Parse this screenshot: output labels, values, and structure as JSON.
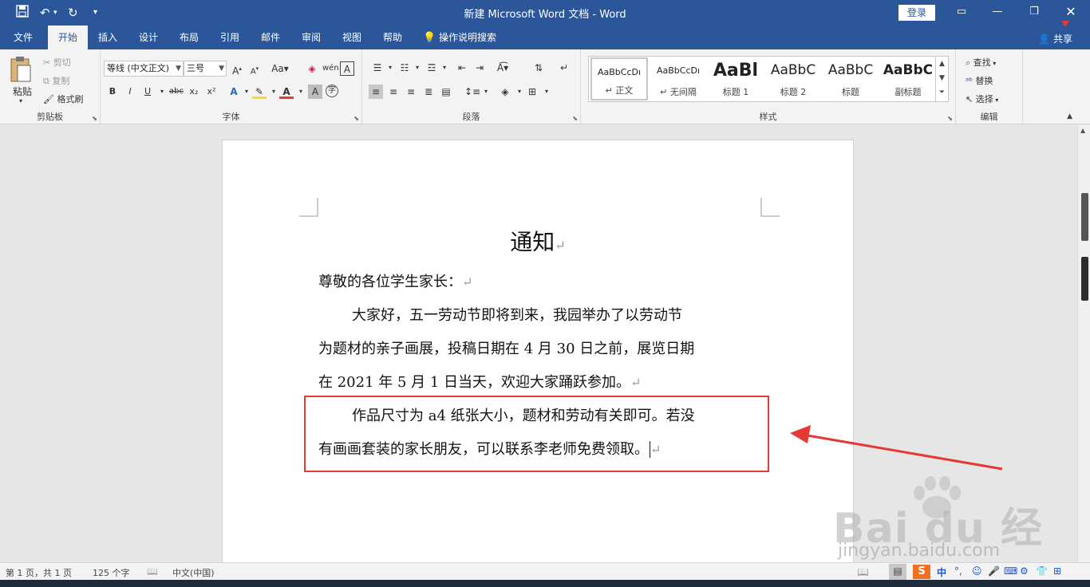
{
  "window": {
    "title": "新建 Microsoft Word 文档  -  Word",
    "login_label": "登录"
  },
  "quick_access": {
    "save_icon": "save-icon",
    "undo_icon": "undo-icon",
    "redo_icon": "redo-icon",
    "customize_icon": "customize-icon"
  },
  "tabs": [
    {
      "label": "文件"
    },
    {
      "label": "开始"
    },
    {
      "label": "插入"
    },
    {
      "label": "设计"
    },
    {
      "label": "布局"
    },
    {
      "label": "引用"
    },
    {
      "label": "邮件"
    },
    {
      "label": "审阅"
    },
    {
      "label": "视图"
    },
    {
      "label": "帮助"
    }
  ],
  "tell_me": "操作说明搜索",
  "share_label": "共享",
  "ribbon": {
    "clipboard": {
      "paste": "粘贴",
      "cut": "剪切",
      "copy": "复制",
      "format_painter": "格式刷",
      "label": "剪贴板"
    },
    "font": {
      "font_name": "等线 (中文正文)",
      "font_size": "三号",
      "label": "字体",
      "bold": "B",
      "italic": "I",
      "underline": "U",
      "strike": "abc",
      "subscript": "x₂",
      "superscript": "x²"
    },
    "paragraph": {
      "label": "段落"
    },
    "styles": {
      "label": "样式",
      "items": [
        {
          "preview": "AaBbCcDı",
          "name": "↵ 正文"
        },
        {
          "preview": "AaBbCcDı",
          "name": "↵ 无间隔"
        },
        {
          "preview": "AaBl",
          "name": "标题 1"
        },
        {
          "preview": "AaBbC",
          "name": "标题 2"
        },
        {
          "preview": "AaBbC",
          "name": "标题"
        },
        {
          "preview": "AaBbC",
          "name": "副标题"
        }
      ]
    },
    "editing": {
      "find": "查找",
      "replace": "替换",
      "select": "选择",
      "label": "编辑"
    }
  },
  "document": {
    "title": "通知",
    "salutation": "尊敬的各位学生家长：",
    "p1_line1": "大家好，五一劳动节即将到来，我园举办了以劳动节",
    "p1_line2": "为题材的亲子画展，投稿日期在 4 月 30 日之前，展览日期",
    "p1_line3": "在 2021 年 5 月 1 日当天，欢迎大家踊跃参加。",
    "p2_line1": "作品尺寸为 a4 纸张大小，题材和劳动有关即可。若没",
    "p2_line2": "有画画套装的家长朋友，可以联系李老师免费领取。",
    "para_mark": "↵"
  },
  "status": {
    "page": "第 1 页，共 1 页",
    "words": "125 个字",
    "language": "中文(中国)"
  },
  "ime": {
    "label": "中"
  },
  "watermark": {
    "brand": "Bai du 经验",
    "url": "jingyan.baidu.com"
  },
  "colors": {
    "accent": "#2b579a",
    "highlight_box": "#e53935"
  }
}
